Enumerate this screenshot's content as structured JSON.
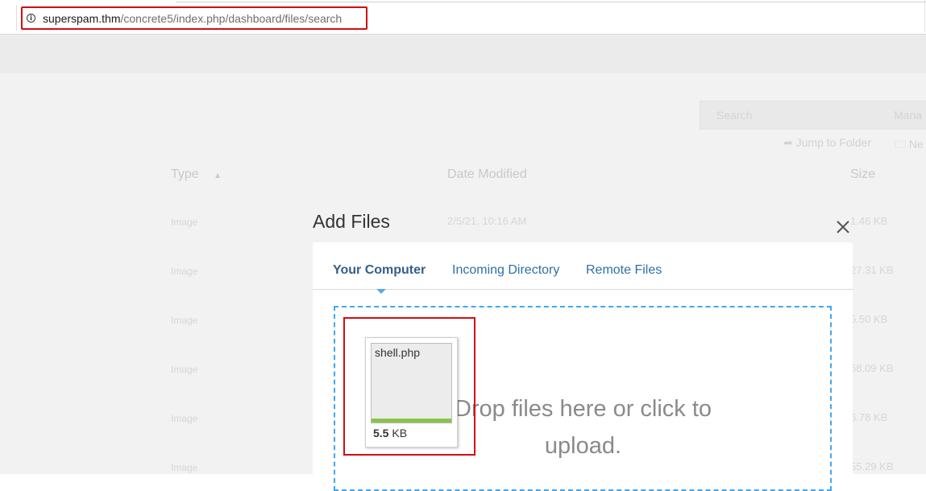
{
  "browser": {
    "url_host": "superspam.thm",
    "url_path": "/concrete5/index.php/dashboard/files/search"
  },
  "background": {
    "search_placeholder": "Search",
    "search_trailing": "Mana",
    "jump_to_folder": "Jump to Folder",
    "new_folder_partial": "Ne",
    "columns": {
      "type": "Type",
      "date_modified": "Date Modified",
      "size": "Size"
    },
    "rows": [
      {
        "type": "Image",
        "date": "2/5/21, 10:16 AM",
        "size": "1.46 KB"
      },
      {
        "type": "Image",
        "date": "",
        "size": "27.31 KB"
      },
      {
        "type": "Image",
        "date": "",
        "size": "5.50 KB"
      },
      {
        "type": "Image",
        "date": "",
        "size": "58.09 KB"
      },
      {
        "type": "Image",
        "date": "",
        "size": "6.78 KB"
      },
      {
        "type": "Image",
        "date": "",
        "size": "55.29 KB"
      }
    ]
  },
  "modal": {
    "title": "Add Files",
    "tabs": [
      {
        "label": "Your Computer",
        "active": true
      },
      {
        "label": "Incoming Directory",
        "active": false
      },
      {
        "label": "Remote Files",
        "active": false
      }
    ],
    "dropzone_message": "Drop files here or click to upload.",
    "file": {
      "name": "shell.php",
      "size_value": "5.5",
      "size_unit": "KB",
      "upload_progress": 1.0
    }
  },
  "colors": {
    "highlight_red": "#d40d12",
    "tab_link": "#2f6fa7",
    "dropzone_border": "#41a6f0",
    "progress_green": "#8bc34a"
  }
}
